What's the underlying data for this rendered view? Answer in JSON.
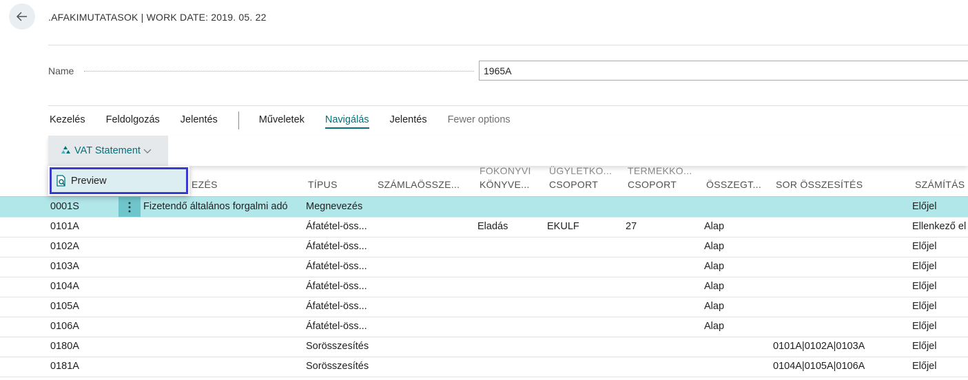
{
  "header": {
    "title": ".AFAKIMUTATASOK | WORK DATE: 2019. 05. 22"
  },
  "form": {
    "name_label": "Name",
    "name_value": "1965A"
  },
  "tabs": [
    {
      "label": "Kezelés"
    },
    {
      "label": "Feldolgozás"
    },
    {
      "label": "Jelentés"
    },
    {
      "label": "Műveletek"
    },
    {
      "label": "Navigálás",
      "active": true
    },
    {
      "label": "Jelentés"
    },
    {
      "label": "Fewer options"
    }
  ],
  "action": {
    "vat_statement_label": "VAT Statement",
    "preview_label": "Preview"
  },
  "columns": {
    "nev_suffix": "EZÉS",
    "tipus": "TÍPUS",
    "szamla": "SZÁMLAÖSSZE...",
    "fokonyvi_top": "FOKONYVI",
    "fokonyvi_bottom": "KÖNYVE...",
    "ugylet_top": "ÜGYLETKO...",
    "ugylet_bottom": "CSOPORT",
    "termek_top": "TERMEKKO...",
    "termek_bottom": "CSOPORT",
    "osszeg": "ÖSSZEGT...",
    "sor": "SOR ÖSSZESÍTÉS",
    "szamitas": "SZÁMÍTÁS"
  },
  "rows": [
    {
      "code": "0001S",
      "desc": "Fizetendő általános forgalmi adó",
      "type": "Megnevezés",
      "konyv": "",
      "ugylet": "",
      "termek": "",
      "osszeg": "",
      "sor": "",
      "calc": "Előjel",
      "selected": true
    },
    {
      "code": "0101A",
      "desc": "",
      "type": "Áfatétel-öss...",
      "konyv": "Eladás",
      "ugylet": "EKULF",
      "termek": "27",
      "osszeg": "Alap",
      "sor": "",
      "calc": "Ellenkező el"
    },
    {
      "code": "0102A",
      "desc": "",
      "type": "Áfatétel-öss...",
      "konyv": "",
      "ugylet": "",
      "termek": "",
      "osszeg": "Alap",
      "sor": "",
      "calc": "Előjel"
    },
    {
      "code": "0103A",
      "desc": "",
      "type": "Áfatétel-öss...",
      "konyv": "",
      "ugylet": "",
      "termek": "",
      "osszeg": "Alap",
      "sor": "",
      "calc": "Előjel"
    },
    {
      "code": "0104A",
      "desc": "",
      "type": "Áfatétel-öss...",
      "konyv": "",
      "ugylet": "",
      "termek": "",
      "osszeg": "Alap",
      "sor": "",
      "calc": "Előjel"
    },
    {
      "code": "0105A",
      "desc": "",
      "type": "Áfatétel-öss...",
      "konyv": "",
      "ugylet": "",
      "termek": "",
      "osszeg": "Alap",
      "sor": "",
      "calc": "Előjel"
    },
    {
      "code": "0106A",
      "desc": "",
      "type": "Áfatétel-öss...",
      "konyv": "",
      "ugylet": "",
      "termek": "",
      "osszeg": "Alap",
      "sor": "",
      "calc": "Előjel"
    },
    {
      "code": "0180A",
      "desc": "",
      "type": "Sorösszesítés",
      "konyv": "",
      "ugylet": "",
      "termek": "",
      "osszeg": "",
      "sor": "0101A|0102A|0103A",
      "calc": "Előjel"
    },
    {
      "code": "0181A",
      "desc": "",
      "type": "Sorösszesítés",
      "konyv": "",
      "ugylet": "",
      "termek": "",
      "osszeg": "",
      "sor": "0104A|0105A|0106A",
      "calc": "Előjel"
    }
  ],
  "colors": {
    "accent": "#00727a",
    "selected_row": "#b2e7ea",
    "focus_border": "#3a3acd"
  },
  "icons": {
    "back": "arrow-left-icon",
    "vat": "recycle-icon",
    "preview": "document-search-icon",
    "menu": "vertical-ellipsis-icon"
  }
}
